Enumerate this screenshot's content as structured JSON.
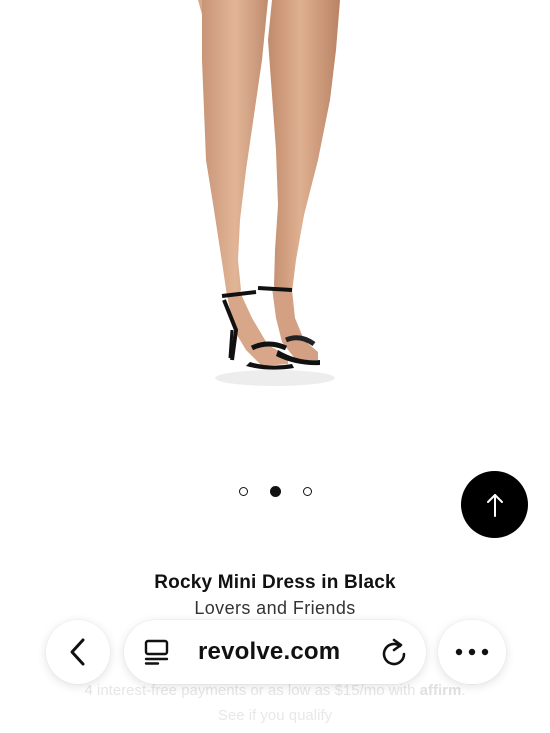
{
  "product": {
    "title": "Rocky Mini Dress in Black",
    "brand": "Lovers and Friends"
  },
  "carousel": {
    "total_images": 3,
    "active_index": 1
  },
  "payment": {
    "text": "4 interest-free payments or as low as $15/mo with",
    "provider": "affirm",
    "suffix": ".",
    "link": "See if you qualify"
  },
  "browser": {
    "url": "revolve.com"
  },
  "icons": {
    "back": "chevron-left-icon",
    "tabs": "tab-list-icon",
    "reload": "reload-icon",
    "more": "more-dots-icon",
    "scroll_top": "arrow-up-icon"
  }
}
